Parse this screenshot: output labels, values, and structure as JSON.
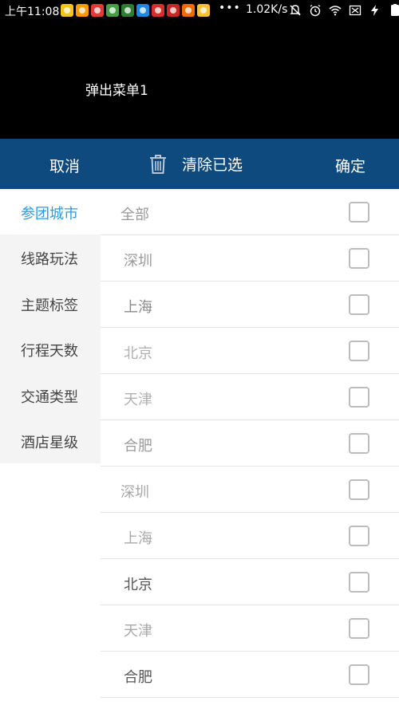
{
  "status_bar": {
    "time": "上午11:08",
    "more": "•••",
    "net_speed": "1.02K/s",
    "notification_icons": [
      {
        "name": "app-icon-1",
        "color": "#f5c518"
      },
      {
        "name": "app-icon-2",
        "color": "#ff9900"
      },
      {
        "name": "app-icon-3",
        "color": "#e53935"
      },
      {
        "name": "app-icon-4",
        "color": "#43a047"
      },
      {
        "name": "app-icon-5",
        "color": "#2e7d32"
      },
      {
        "name": "app-icon-6",
        "color": "#1e88e5"
      },
      {
        "name": "app-icon-7",
        "color": "#d32f2f"
      },
      {
        "name": "app-icon-8",
        "color": "#c62828"
      },
      {
        "name": "app-icon-9",
        "color": "#ef6c00"
      },
      {
        "name": "app-icon-10",
        "color": "#fbc02d"
      }
    ],
    "system_icons": [
      "mute-icon",
      "alarm-icon",
      "wifi-icon",
      "sim-off-icon",
      "charging-icon"
    ]
  },
  "popup": {
    "trigger_label": "弹出菜单1"
  },
  "toolbar": {
    "cancel_label": "取消",
    "clear_label": "清除已选",
    "confirm_label": "确定",
    "background": "#0e4a7e"
  },
  "sidebar": {
    "active_color": "#2d9be3",
    "items": [
      {
        "label": "参团城市",
        "active": true
      },
      {
        "label": "线路玩法",
        "active": false
      },
      {
        "label": "主题标签",
        "active": false
      },
      {
        "label": "行程天数",
        "active": false
      },
      {
        "label": "交通类型",
        "active": false
      },
      {
        "label": "酒店星级",
        "active": false
      }
    ]
  },
  "options": [
    {
      "label": "全部",
      "checked": false,
      "text_color": "#9a9a9a"
    },
    {
      "label": "深圳",
      "checked": false,
      "text_color": "#9a9a9a"
    },
    {
      "label": "上海",
      "checked": false,
      "text_color": "#8a8a8a"
    },
    {
      "label": "北京",
      "checked": false,
      "text_color": "#b0b0b0"
    },
    {
      "label": "天津",
      "checked": false,
      "text_color": "#b0b0b0"
    },
    {
      "label": "合肥",
      "checked": false,
      "text_color": "#9a9a9a"
    },
    {
      "label": "深圳",
      "checked": false,
      "text_color": "#a8a8a8"
    },
    {
      "label": "上海",
      "checked": false,
      "text_color": "#a8a8a8"
    },
    {
      "label": "北京",
      "checked": false,
      "text_color": "#555555"
    },
    {
      "label": "天津",
      "checked": false,
      "text_color": "#a8a8a8"
    },
    {
      "label": "合肥",
      "checked": false,
      "text_color": "#555555"
    }
  ]
}
